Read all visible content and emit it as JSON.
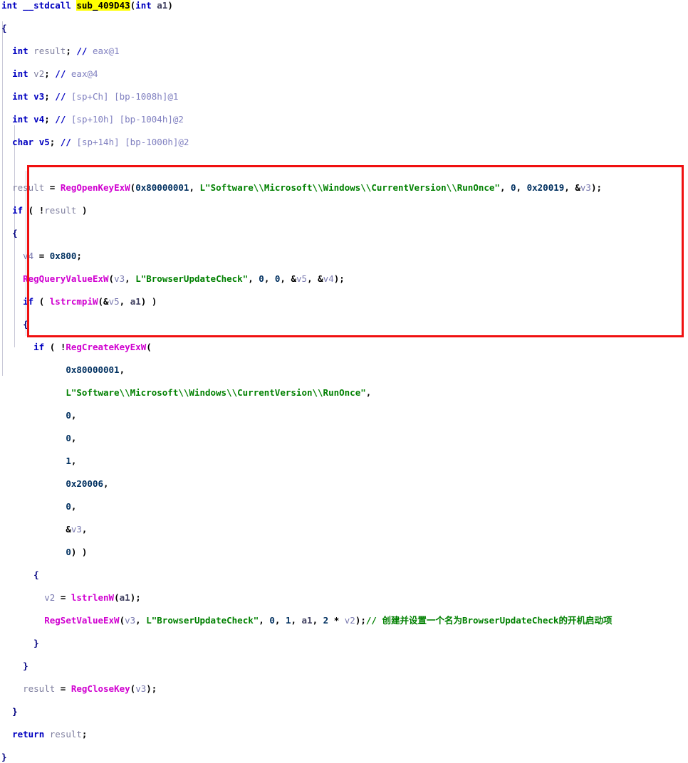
{
  "window": {
    "title": "Hex-Rays Pseudocode",
    "function_name": "sub_409D43",
    "highlight_color": "#ffff00",
    "annotation_color": "#f01010",
    "background_color": "#ffffff"
  },
  "code": {
    "lines": [
      {
        "n": 1,
        "indent": 0,
        "text": "int __stdcall sub_409D43(int a1)"
      },
      {
        "n": 2,
        "indent": 0,
        "text": "{"
      },
      {
        "n": 3,
        "indent": 1,
        "text": "int result; // eax@1"
      },
      {
        "n": 4,
        "indent": 1,
        "text": "int v2; // eax@4"
      },
      {
        "n": 5,
        "indent": 1,
        "text": "int v3; // [sp+Ch] [bp-1008h]@1"
      },
      {
        "n": 6,
        "indent": 1,
        "text": "int v4; // [sp+10h] [bp-1004h]@2"
      },
      {
        "n": 7,
        "indent": 1,
        "text": "char v5; // [sp+14h] [bp-1000h]@2"
      },
      {
        "n": 8,
        "indent": 0,
        "text": ""
      },
      {
        "n": 9,
        "indent": 1,
        "text": "result = RegOpenKeyExW(0x80000001, L\"Software\\\\Microsoft\\\\Windows\\\\CurrentVersion\\\\RunOnce\", 0, 0x20019, &v3);"
      },
      {
        "n": 10,
        "indent": 1,
        "text": "if ( !result )"
      },
      {
        "n": 11,
        "indent": 1,
        "text": "{"
      },
      {
        "n": 12,
        "indent": 2,
        "text": "v4 = 0x800;"
      },
      {
        "n": 13,
        "indent": 2,
        "text": "RegQueryValueExW(v3, L\"BrowserUpdateCheck\", 0, 0, &v5, &v4);"
      },
      {
        "n": 14,
        "indent": 2,
        "text": "if ( lstrcmpiW(&v5, a1) )"
      },
      {
        "n": 15,
        "indent": 2,
        "text": "{"
      },
      {
        "n": 16,
        "indent": 3,
        "text": "if ( !RegCreateKeyExW("
      },
      {
        "n": 17,
        "indent": 6,
        "text": "0x80000001,"
      },
      {
        "n": 18,
        "indent": 6,
        "text": "L\"Software\\\\Microsoft\\\\Windows\\\\CurrentVersion\\\\RunOnce\","
      },
      {
        "n": 19,
        "indent": 6,
        "text": "0,"
      },
      {
        "n": 20,
        "indent": 6,
        "text": "0,"
      },
      {
        "n": 21,
        "indent": 6,
        "text": "1,"
      },
      {
        "n": 22,
        "indent": 6,
        "text": "0x20006,"
      },
      {
        "n": 23,
        "indent": 6,
        "text": "0,"
      },
      {
        "n": 24,
        "indent": 6,
        "text": "&v3,"
      },
      {
        "n": 25,
        "indent": 6,
        "text": "0) )"
      },
      {
        "n": 26,
        "indent": 3,
        "text": "{"
      },
      {
        "n": 27,
        "indent": 4,
        "text": "v2 = lstrlenW(a1);"
      },
      {
        "n": 28,
        "indent": 4,
        "text": "RegSetValueExW(v3, L\"BrowserUpdateCheck\", 0, 1, a1, 2 * v2);// 创建并设置一个名为BrowserUpdateCheck的开机启动项"
      },
      {
        "n": 29,
        "indent": 3,
        "text": "}"
      },
      {
        "n": 30,
        "indent": 2,
        "text": "}"
      },
      {
        "n": 31,
        "indent": 2,
        "text": "result = RegCloseKey(v3);"
      },
      {
        "n": 32,
        "indent": 1,
        "text": "}"
      },
      {
        "n": 33,
        "indent": 1,
        "text": "return result;"
      },
      {
        "n": 34,
        "indent": 0,
        "text": "}"
      }
    ],
    "identifiers": {
      "return_type": "int",
      "calling_convention": "__stdcall",
      "parameter": "int a1",
      "locals": [
        "result",
        "v2",
        "v3",
        "v4",
        "v5"
      ],
      "api_calls": [
        "RegOpenKeyExW",
        "RegQueryValueExW",
        "lstrcmpiW",
        "RegCreateKeyExW",
        "lstrlenW",
        "RegSetValueExW",
        "RegCloseKey"
      ],
      "strings": [
        "L\"Software\\\\Microsoft\\\\Windows\\\\CurrentVersion\\\\RunOnce\"",
        "L\"BrowserUpdateCheck\""
      ],
      "constants": [
        "0x80000001",
        "0x20019",
        "0x800",
        "0x20006"
      ],
      "registry_value_name": "BrowserUpdateCheck",
      "registry_key_path": "Software\\Microsoft\\Windows\\CurrentVersion\\RunOnce"
    },
    "comment": "// 创建并设置一个名为BrowserUpdateCheck的开机启动项"
  }
}
